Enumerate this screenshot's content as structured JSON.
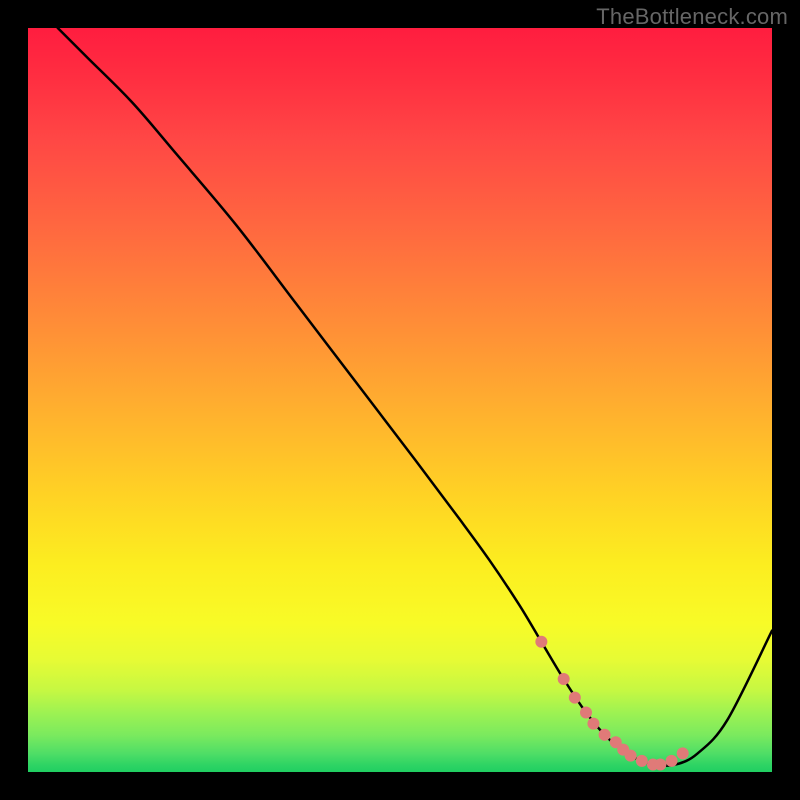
{
  "watermark": "TheBottleneck.com",
  "chart_data": {
    "type": "line",
    "title": "",
    "xlabel": "",
    "ylabel": "",
    "xlim": [
      0,
      100
    ],
    "ylim": [
      0,
      100
    ],
    "grid": false,
    "legend": false,
    "curve": {
      "name": "bottleneck-curve",
      "color": "#000000",
      "x": [
        4,
        8,
        14,
        20,
        28,
        36,
        44,
        52,
        58,
        62,
        66,
        69,
        72,
        75,
        78,
        81,
        84,
        87,
        90,
        94,
        100
      ],
      "y": [
        100,
        96,
        90,
        83,
        73.5,
        63,
        52.5,
        42,
        34,
        28.5,
        22.5,
        17.5,
        12.5,
        8,
        4.5,
        2.2,
        1,
        1,
        2.5,
        7,
        19
      ]
    },
    "markers": {
      "name": "optimal-region",
      "color": "#e07a78",
      "radius_px": 6,
      "x": [
        69,
        72,
        73.5,
        75,
        76,
        77.5,
        79,
        80,
        81,
        82.5,
        84,
        85,
        86.5,
        88
      ],
      "y": [
        17.5,
        12.5,
        10,
        8,
        6.5,
        5,
        4,
        3,
        2.2,
        1.5,
        1,
        1,
        1.5,
        2.5
      ]
    },
    "gradient_stops": [
      {
        "pos": 0,
        "color": "#ff1d3f"
      },
      {
        "pos": 25,
        "color": "#ff6b3f"
      },
      {
        "pos": 50,
        "color": "#ffb22e"
      },
      {
        "pos": 72,
        "color": "#fced20"
      },
      {
        "pos": 88,
        "color": "#c6f842"
      },
      {
        "pos": 100,
        "color": "#20cf62"
      }
    ]
  }
}
